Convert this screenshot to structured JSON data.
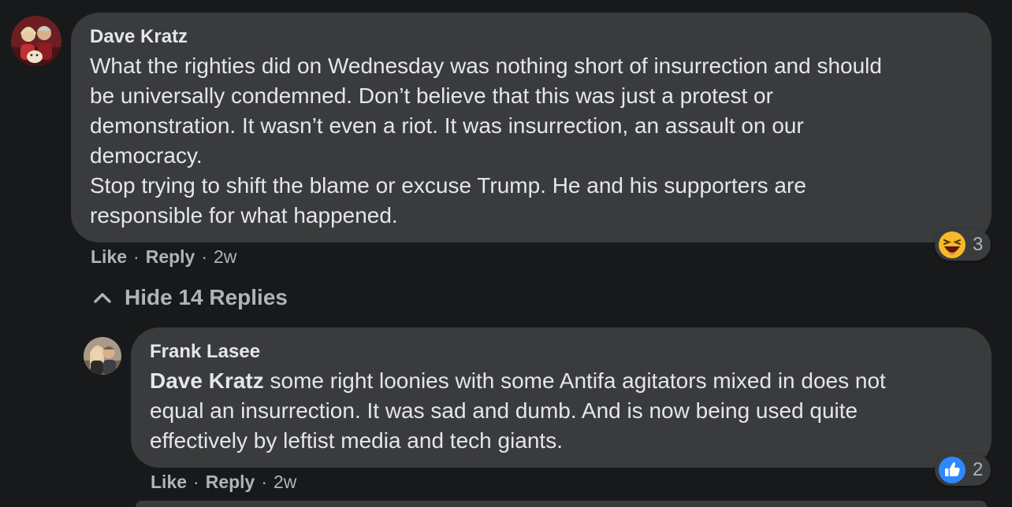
{
  "first_comment": {
    "author": "Dave Kratz",
    "lines": [
      "What the righties did on Wednesday was nothing short of insurrection and should",
      "be universally condemned. Don’t believe that this was just a protest or",
      "demonstration. It wasn’t even a riot. It was insurrection, an assault on our",
      "democracy.",
      "Stop trying to shift the blame or excuse Trump. He and his supporters are",
      "responsible for what happened."
    ],
    "like_label": "Like",
    "reply_label": "Reply",
    "separator": "·",
    "time": "2w",
    "reaction": {
      "icon": "haha-emoji-icon",
      "count": "3"
    }
  },
  "replies_toggle": {
    "label": "Hide 14 Replies",
    "icon": "chevron-up-icon"
  },
  "reply_comment": {
    "author": "Frank Lasee",
    "mention": "Dave Kratz",
    "first_line_rest": " some right loonies with some Antifa agitators mixed in does not",
    "lines": [
      "equal an insurrection. It was sad and dumb. And is now being used quite",
      "effectively by leftist media and tech giants."
    ],
    "like_label": "Like",
    "reply_label": "Reply",
    "separator": "·",
    "time": "2w",
    "reaction": {
      "icon": "like-thumb-icon",
      "count": "2"
    }
  },
  "colors": {
    "background": "#18191a",
    "bubble": "#3a3b3c",
    "primary_text": "#e4e6eb",
    "secondary_text": "#b0b3b8",
    "like_blue": "#2d88ff",
    "haha_yellow": "#f7b928"
  }
}
